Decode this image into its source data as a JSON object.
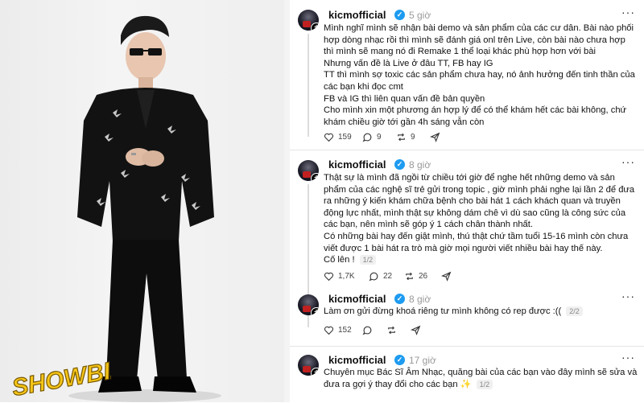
{
  "watermark": "SHOWBIZ",
  "posts": [
    {
      "username": "kicmofficial",
      "time": "5 giờ",
      "lines": [
        "Mình nghĩ mình sẽ nhận bài demo và sản phẩm của các cư dân. Bài nào phối hợp dòng nhạc rồi thì mình sẽ đánh giá onl trên Live, còn bài nào chưa hợp thì mình sẽ mang nó đi Remake 1 thể loại khác phù hợp hơn với bài",
        "Nhưng vấn đề là Live ở đâu TT, FB hay IG",
        "TT thì mình sợ toxic các sản phẩm chưa hay, nó ảnh hưởng đến tinh thần của các bạn khi đọc cmt",
        "FB và IG thì liên quan vấn đề bản quyền",
        "Cho mình xin một phương án hợp lý để có thể khám hết các bài không, chứ khám chiều giờ tới gần 4h sáng vẫn còn"
      ],
      "page": "",
      "likes": "159",
      "comments": "9",
      "reposts": "9",
      "shares": ""
    },
    {
      "username": "kicmofficial",
      "time": "8 giờ",
      "lines": [
        "Thật sự là mình đã ngồi từ chiều tới giờ để nghe hết những demo và sản phẩm của các nghệ sĩ trẻ gửi trong topic , giờ mình phải nghe lại lần 2 để đưa ra những ý kiến khám chữa bệnh cho bài hát 1 cách khách quan và truyền động lực nhất, mình thật sự không dám chê vì dù sao cũng là công sức của các bạn, nên mình sẽ góp ý 1 cách chân thành nhất.",
        "Có những bài hay đến giật mình, thú thật chứ tầm tuổi 15-16 mình còn chưa viết được 1 bài hát ra trò mà giờ mọi người viết nhiều bài hay thế này.",
        "Cố lên !"
      ],
      "page": "1/2",
      "likes": "1,7K",
      "comments": "22",
      "reposts": "26",
      "shares": ""
    },
    {
      "username": "kicmofficial",
      "time": "8 giờ",
      "lines": [
        "Làm ơn gửi đừng khoá riêng tư mình không có rep được :(("
      ],
      "page": "2/2",
      "likes": "152",
      "comments": "",
      "reposts": "",
      "shares": ""
    },
    {
      "username": "kicmofficial",
      "time": "17 giờ",
      "lines": [
        "Chuyên mục Bác Sĩ Âm Nhạc, quăng bài của các bạn vào đây mình sẽ sửa và đưa ra gợi ý thay đổi cho các bạn ✨"
      ],
      "page": "1/2",
      "likes": "",
      "comments": "",
      "reposts": "",
      "shares": ""
    }
  ],
  "colors": {
    "verified": "#1d9bf0",
    "text": "#111111",
    "muted": "#9a9a9a",
    "logo_yellow": "#f5c518"
  }
}
